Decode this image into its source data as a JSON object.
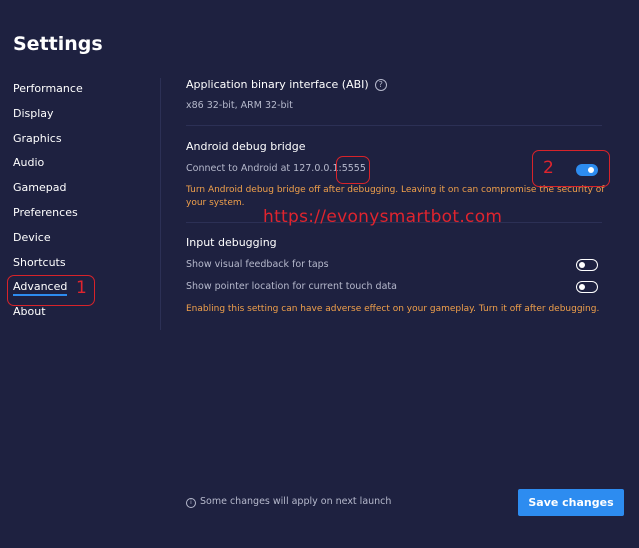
{
  "page": {
    "title": "Settings"
  },
  "sidebar": {
    "items": [
      {
        "label": "Performance"
      },
      {
        "label": "Display"
      },
      {
        "label": "Graphics"
      },
      {
        "label": "Audio"
      },
      {
        "label": "Gamepad"
      },
      {
        "label": "Preferences"
      },
      {
        "label": "Device"
      },
      {
        "label": "Shortcuts"
      },
      {
        "label": "Advanced",
        "active": true
      },
      {
        "label": "About"
      }
    ]
  },
  "abi": {
    "title": "Application binary interface (ABI)",
    "value": "x86 32-bit, ARM 32-bit"
  },
  "adb": {
    "title": "Android debug bridge",
    "connect_text": "Connect to Android at 127.0.0.1:5555",
    "enabled": true,
    "warning": "Turn Android debug bridge off after debugging. Leaving it on can compromise the security of your system."
  },
  "input_debugging": {
    "title": "Input debugging",
    "visual_feedback_label": "Show visual feedback for taps",
    "visual_feedback_enabled": false,
    "pointer_location_label": "Show pointer location for current touch data",
    "pointer_location_enabled": false,
    "warning": "Enabling this setting can have adverse effect on your gameplay. Turn it off after  debugging."
  },
  "overlay": {
    "watermark": "https://evonysmartbot.com",
    "annotation_1": "1",
    "annotation_2": "2"
  },
  "footer": {
    "note": "Some changes will apply on next launch",
    "save_label": "Save changes"
  },
  "colors": {
    "background": "#1e2140",
    "accent": "#2d8cf0",
    "warning": "#f0a04b",
    "annotation": "#e0242e"
  }
}
